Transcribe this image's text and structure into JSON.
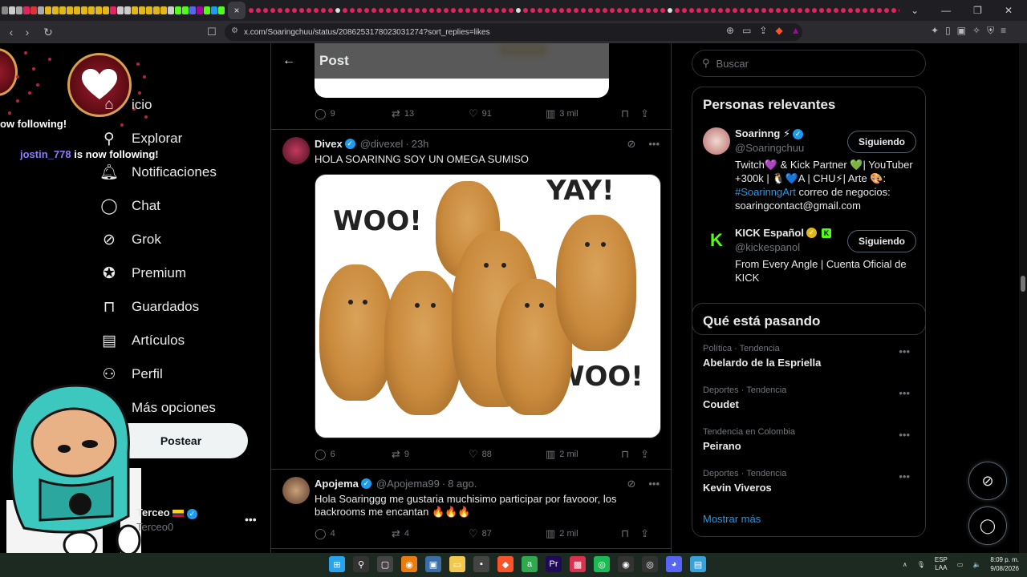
{
  "browser": {
    "url": "x.com/Soaringchuu/status/2086253178023031274?sort_replies=likes",
    "active_tab_close": "×",
    "new_tab": "+"
  },
  "overlay": {
    "follow1": "ow following!",
    "follow2_user": "jostin_778",
    "follow2_text": " is now following!"
  },
  "nav": {
    "items": [
      {
        "label": "icio",
        "icon": "home-icon"
      },
      {
        "label": "Explorar",
        "icon": "search-icon"
      },
      {
        "label": "Notificaciones",
        "icon": "bell-icon"
      },
      {
        "label": "Chat",
        "icon": "chat-icon"
      },
      {
        "label": "Grok",
        "icon": "grok-icon"
      },
      {
        "label": "Premium",
        "icon": "premium-icon"
      },
      {
        "label": "Guardados",
        "icon": "bookmark-icon"
      },
      {
        "label": "Artículos",
        "icon": "article-icon"
      },
      {
        "label": "Perfil",
        "icon": "profile-icon"
      },
      {
        "label": "Más opciones",
        "icon": "more-icon"
      }
    ],
    "post_button": "Postear",
    "account_name": "Terceo",
    "account_handle": "Terceo0"
  },
  "header": {
    "title": "Post"
  },
  "prev_actions": {
    "replies": "9",
    "reposts": "13",
    "likes": "91",
    "views": "3 mil"
  },
  "tweets": [
    {
      "name": "Divex",
      "handle": "@divexel",
      "time": "23h",
      "text": "HOLA SOARINNG SOY UN OMEGA SUMISO",
      "gif_text": [
        "WOO!",
        "YAY!",
        "WOO!"
      ],
      "replies": "6",
      "reposts": "9",
      "likes": "88",
      "views": "2 mil"
    },
    {
      "name": "Apojema",
      "handle": "@Apojema99",
      "time": "8 ago.",
      "text": "Hola Soaringgg me gustaria muchisimo participar por favooor, los backrooms me encantan 🔥🔥🔥",
      "replies": "4",
      "reposts": "4",
      "likes": "87",
      "views": "2 mil"
    }
  ],
  "search": {
    "placeholder": "Buscar"
  },
  "relevant": {
    "title": "Personas relevantes",
    "people": [
      {
        "name": "Soarinng ⚡",
        "handle": "@Soaringchuu",
        "button": "Siguiendo",
        "bio_pre": "Twitch💜 & Kick Partner 💚| YouTuber +300k | 🐧💙A | CHU⚡| Arte 🎨: ",
        "bio_tag": "#SoarinngArt",
        "bio_post": " correo de negocios: soaringcontact@gmail.com"
      },
      {
        "name": "KICK Español",
        "handle": "@kickespanol",
        "button": "Siguiendo",
        "bio_pre": "From Every Angle | Cuenta Oficial de KICK",
        "bio_tag": "",
        "bio_post": ""
      }
    ]
  },
  "trending": {
    "title": "Qué está pasando",
    "items": [
      {
        "category": "Política · Tendencia",
        "name": "Abelardo de la Espriella"
      },
      {
        "category": "Deportes · Tendencia",
        "name": "Coudet"
      },
      {
        "category": "Tendencia en Colombia",
        "name": "Peirano"
      },
      {
        "category": "Deportes · Tendencia",
        "name": "Kevin Viveros"
      }
    ],
    "show_more": "Mostrar más"
  },
  "taskbar": {
    "lang1": "ESP",
    "lang2": "LAA",
    "time": "8:09 p. m.",
    "date": "9/08/2026"
  },
  "colors": {
    "accent": "#1d9bf0",
    "background": "#000000",
    "border": "#2f3336",
    "muted": "#71767b"
  }
}
